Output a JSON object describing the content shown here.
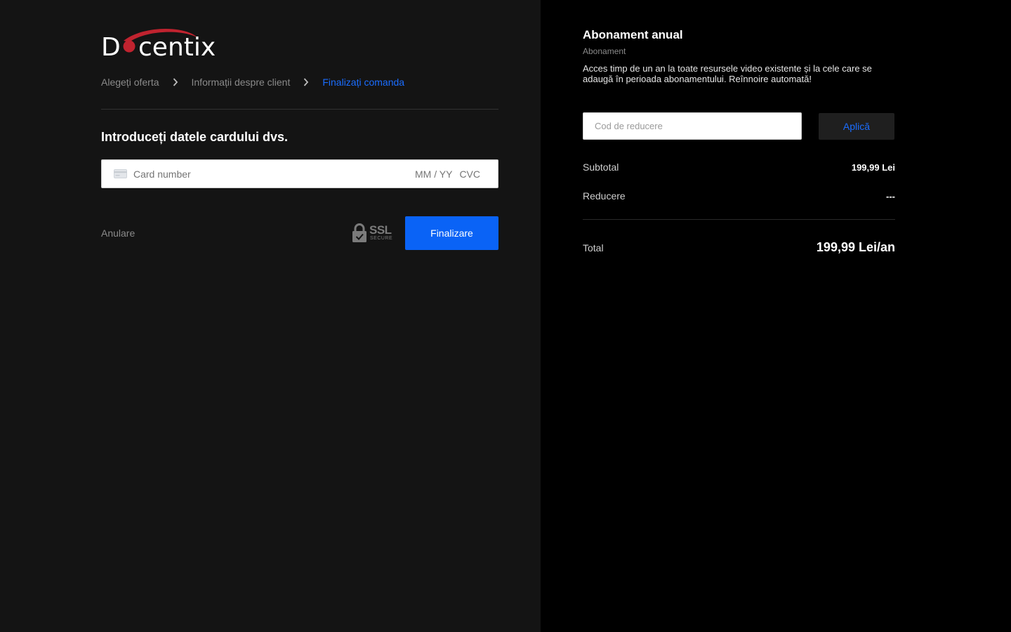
{
  "logo": {
    "text": "Docentix",
    "accent_color": "#c0232f"
  },
  "breadcrumb": {
    "items": [
      {
        "label": "Alegeți oferta",
        "active": false
      },
      {
        "label": "Informații despre client",
        "active": false
      },
      {
        "label": "Finalizați comanda",
        "active": true
      }
    ],
    "separator_icon": "chevron-right-icon"
  },
  "payment": {
    "title": "Introduceți datele cardului dvs.",
    "card_icon": "credit-card-icon",
    "card_number_placeholder": "Card number",
    "expiry_placeholder": "MM / YY",
    "cvc_placeholder": "CVC",
    "cancel_label": "Anulare",
    "ssl_label": "SSL",
    "ssl_sub_label": "SECURE",
    "ssl_icon": "lock-icon",
    "submit_label": "Finalizare"
  },
  "order": {
    "plan_title": "Abonament anual",
    "plan_type": "Abonament",
    "plan_description": "Acces timp de un an la toate resursele video existente și la cele care se adaugă în perioada abonamentului. Reînnoire automată!",
    "discount_placeholder": "Cod de reducere",
    "apply_label": "Aplică",
    "subtotal_label": "Subtotal",
    "subtotal_value": "199,99 Lei",
    "discount_label": "Reducere",
    "discount_value": "---",
    "total_label": "Total",
    "total_value": "199,99 Lei/an"
  },
  "colors": {
    "accent_blue": "#0a63f6",
    "link_blue": "#1a6dff",
    "left_bg": "#141414",
    "right_bg": "#000000"
  }
}
